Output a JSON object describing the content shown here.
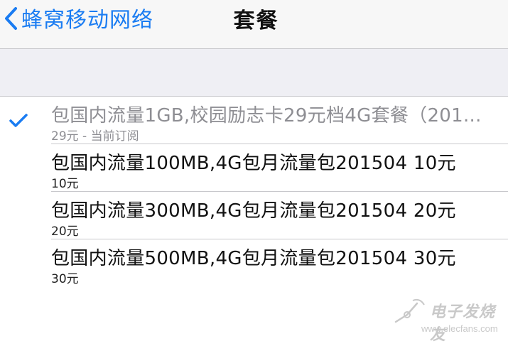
{
  "nav": {
    "back_label": "蜂窝移动网络",
    "title": "套餐"
  },
  "plans": [
    {
      "title": "包国内流量1GB,校园励志卡29元档4G套餐（201...",
      "subtitle": "29元 - 当前订阅",
      "selected": true
    },
    {
      "title": "包国内流量100MB,4G包月流量包201504 10元",
      "subtitle": "10元",
      "selected": false
    },
    {
      "title": "包国内流量300MB,4G包月流量包201504 20元",
      "subtitle": "20元",
      "selected": false
    },
    {
      "title": "包国内流量500MB,4G包月流量包201504 30元",
      "subtitle": "30元",
      "selected": false
    }
  ],
  "watermark": {
    "name": "电子发烧友",
    "url": "www.elecfans.com"
  },
  "colors": {
    "accent": "#1a7cf2",
    "separator": "#c8c8cc",
    "band": "#efeff4"
  }
}
